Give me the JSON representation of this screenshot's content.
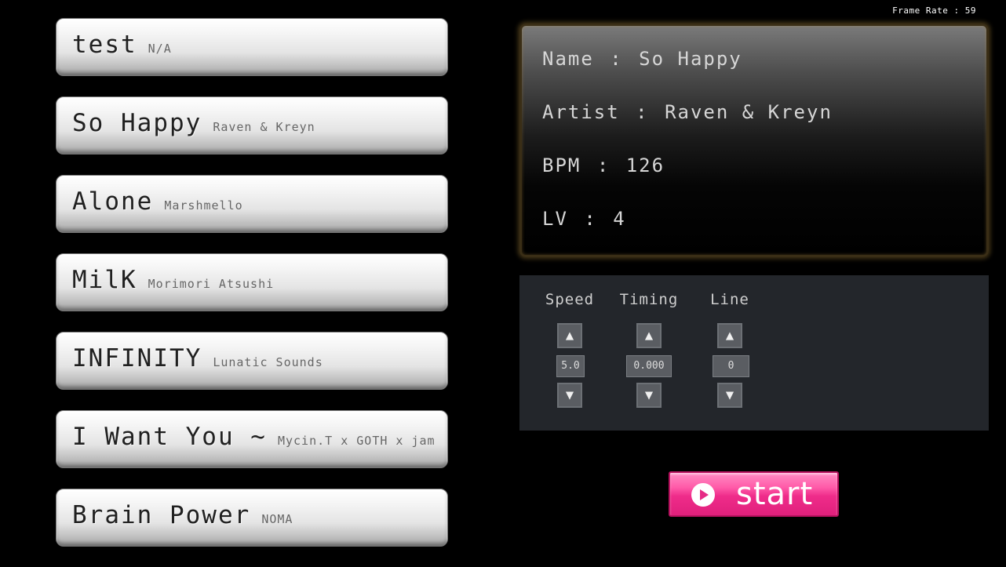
{
  "frame_rate": {
    "label": "Frame Rate",
    "separator": ":",
    "value": "59"
  },
  "songs": [
    {
      "title": "test",
      "artist": "N/A"
    },
    {
      "title": "So Happy",
      "artist": "Raven & Kreyn"
    },
    {
      "title": "Alone",
      "artist": "Marshmello"
    },
    {
      "title": "MilK",
      "artist": "Morimori Atsushi"
    },
    {
      "title": "INFINITY",
      "artist": "Lunatic Sounds"
    },
    {
      "title": "I Want You ~",
      "artist": "Mycin.T x GOTH x jam"
    },
    {
      "title": "Brain Power",
      "artist": "NOMA"
    }
  ],
  "info": {
    "separator": ":",
    "name_label": "Name",
    "name_value": "So Happy",
    "artist_label": "Artist",
    "artist_value": "Raven & Kreyn",
    "bpm_label": "BPM",
    "bpm_value": "126",
    "lv_label": "LV",
    "lv_value": "4"
  },
  "settings": {
    "up_glyph": "▲",
    "down_glyph": "▼",
    "speed": {
      "label": "Speed",
      "value": "5.0"
    },
    "timing": {
      "label": "Timing",
      "value": "0.000"
    },
    "line": {
      "label": "Line",
      "value": "0"
    }
  },
  "start_button": {
    "label": "start",
    "icon": "play-icon"
  },
  "colors": {
    "background": "#000000",
    "list_item": "#e4e4e4",
    "panel_border": "#3a2e16",
    "settings_bg": "#23262b",
    "start_button": "#ef2c8a"
  }
}
